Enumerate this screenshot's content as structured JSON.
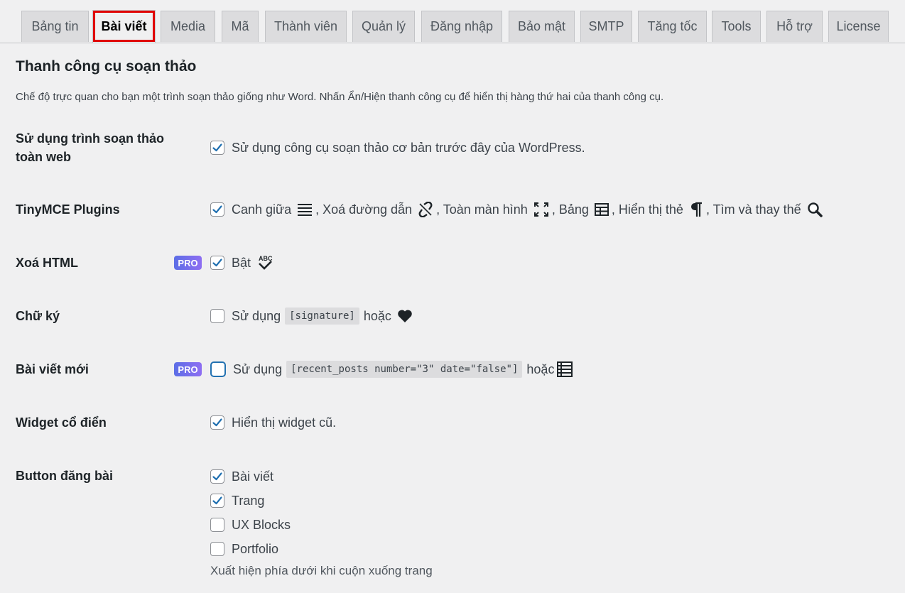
{
  "tabs": [
    {
      "label": "Bảng tin"
    },
    {
      "label": "Bài viết"
    },
    {
      "label": "Media"
    },
    {
      "label": "Mã"
    },
    {
      "label": "Thành viên"
    },
    {
      "label": "Quản lý"
    },
    {
      "label": "Đăng nhập"
    },
    {
      "label": "Bảo mật"
    },
    {
      "label": "SMTP"
    },
    {
      "label": "Tăng tốc"
    },
    {
      "label": "Tools"
    },
    {
      "label": "Hỗ trợ"
    },
    {
      "label": "License"
    }
  ],
  "active_tab": "Bài viết",
  "section": {
    "title": "Thanh công cụ soạn thảo",
    "description": "Chế độ trực quan cho bạn một trình soạn thảo giống như Word. Nhấn Ẩn/Hiện thanh công cụ để hiển thị hàng thứ hai của thanh công cụ."
  },
  "rows": {
    "classic_editor": {
      "label": "Sử dụng trình soạn thảo toàn web",
      "option": "Sử dụng công cụ soạn thảo cơ bản trước đây của WordPress.",
      "checked": true
    },
    "tinymce": {
      "label": "TinyMCE Plugins",
      "checked": true,
      "items": {
        "center": "Canh giữa",
        "unlink": ", Xoá đường dẫn",
        "fullscreen": ", Toàn màn hình",
        "table": ", Bảng",
        "visualblocks": ", Hiển thị thẻ",
        "searchreplace": ", Tìm và thay thế"
      }
    },
    "clean_html": {
      "label": "Xoá HTML",
      "badge": "PRO",
      "option": "Bật",
      "checked": true
    },
    "signature": {
      "label": "Chữ ký",
      "prefix": "Sử dụng",
      "shortcode": "[signature]",
      "suffix": "hoặc",
      "checked": false
    },
    "recent_posts": {
      "label": "Bài viết mới",
      "badge": "PRO",
      "prefix": "Sử dụng",
      "shortcode": "[recent_posts number=\"3\" date=\"false\"]",
      "suffix": "hoặc",
      "checked": false
    },
    "classic_widget": {
      "label": "Widget cổ điển",
      "option": "Hiển thị widget cũ.",
      "checked": true
    },
    "post_button": {
      "label": "Button đăng bài",
      "options": [
        {
          "label": "Bài viết",
          "checked": true
        },
        {
          "label": "Trang",
          "checked": true
        },
        {
          "label": "UX Blocks",
          "checked": false
        },
        {
          "label": "Portfolio",
          "checked": false
        }
      ],
      "note": "Xuất hiện phía dưới khi cuộn xuống trang"
    }
  },
  "colors": {
    "accent": "#2271b1",
    "highlight": "#e00000",
    "pro_badge": "#6a6ee8",
    "background": "#f0f0f1"
  }
}
